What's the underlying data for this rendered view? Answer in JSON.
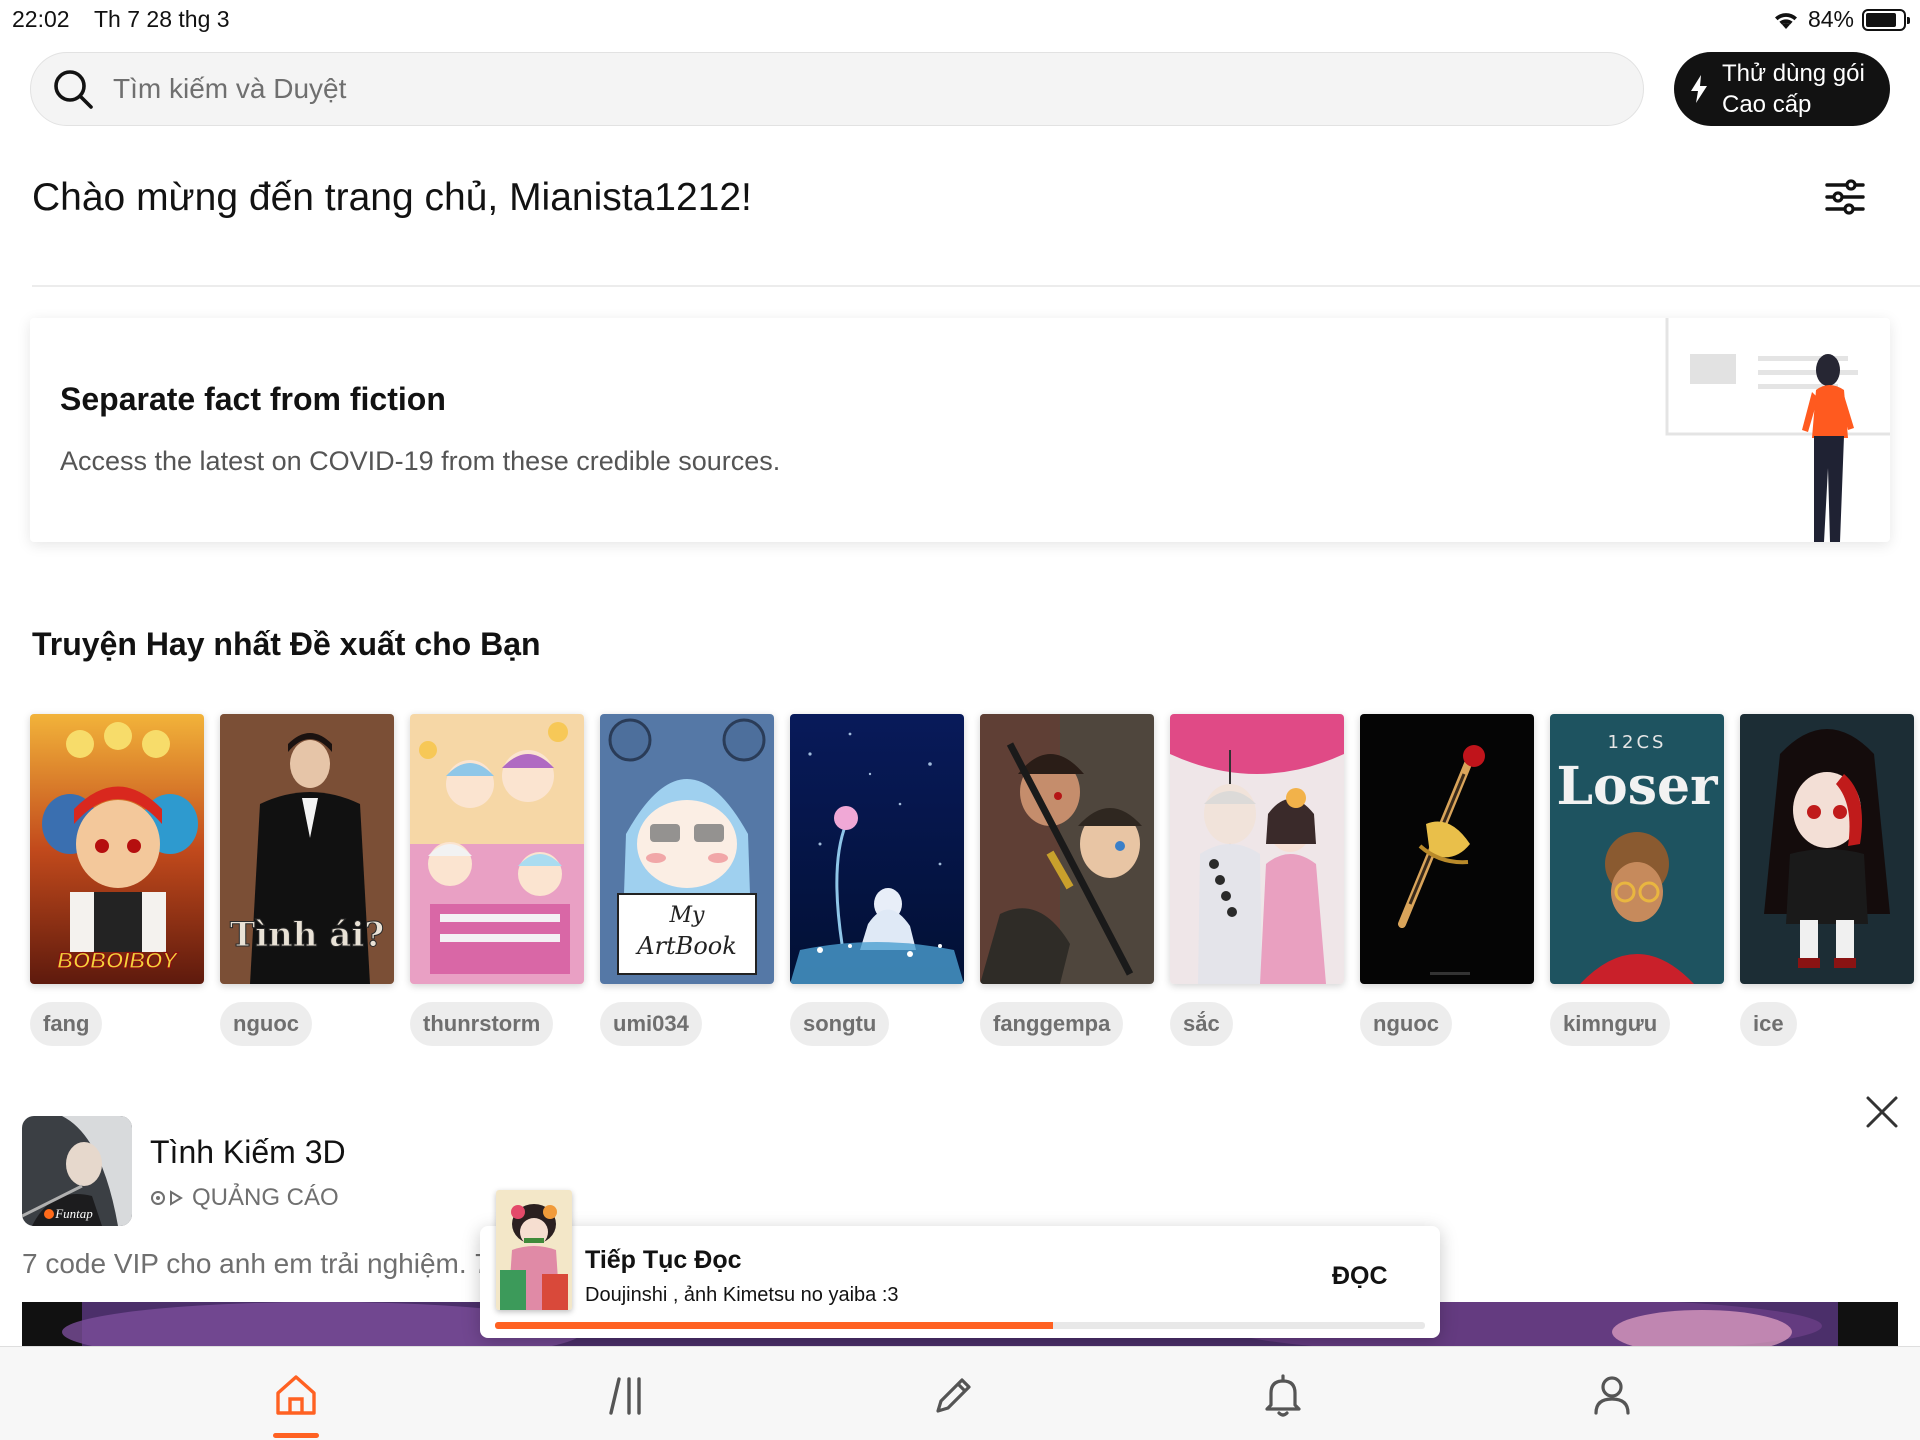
{
  "status_bar": {
    "time": "22:02",
    "date": "Th 7 28 thg 3",
    "battery": "84%",
    "battery_level": 0.84
  },
  "search": {
    "placeholder": "Tìm kiếm và Duyệt"
  },
  "premium": {
    "label": "Thử dùng gói Cao cấp"
  },
  "greeting": "Chào mừng đến trang chủ, Mianista1212!",
  "covid_card": {
    "title": "Separate fact from fiction",
    "subtitle": "Access the latest on COVID-19 from these credible sources."
  },
  "recommendations": {
    "title": "Truyện Hay nhất Đề xuất cho Bạn",
    "books": [
      {
        "tag": "fang"
      },
      {
        "tag": "nguoc"
      },
      {
        "tag": "thunrstorm"
      },
      {
        "tag": "umi034"
      },
      {
        "tag": "songtu"
      },
      {
        "tag": "fanggempa"
      },
      {
        "tag": "sắc"
      },
      {
        "tag": "nguoc"
      },
      {
        "tag": "kimngưu"
      },
      {
        "tag": "ice"
      }
    ],
    "cover_texts": {
      "boboiboy": "BOBOIBOY",
      "tinh_ai": "Tình ái?",
      "artbook_1": "My",
      "artbook_2": "ArtBook",
      "loser_top": "12CS",
      "loser": "Loser"
    }
  },
  "ad": {
    "title": "Tình Kiếm 3D",
    "label": "QUẢNG CÁO",
    "description": "7 code VIP cho anh em trải nghiệm.  7",
    "thumb_text": "Funtap"
  },
  "continue_reading": {
    "title": "Tiếp Tục Đọc",
    "subtitle": "Doujinshi , ảnh Kimetsu no yaiba :3",
    "button": "ĐỌC",
    "progress": 0.6
  },
  "tab_bar": {
    "tabs": [
      {
        "name": "home-icon",
        "active": true
      },
      {
        "name": "library-icon",
        "active": false
      },
      {
        "name": "pencil-icon",
        "active": false
      },
      {
        "name": "bell-icon",
        "active": false
      },
      {
        "name": "profile-icon",
        "active": false
      }
    ]
  },
  "colors": {
    "accent": "#ff6122",
    "dark": "#121212",
    "muted": "#6f6f6f"
  }
}
